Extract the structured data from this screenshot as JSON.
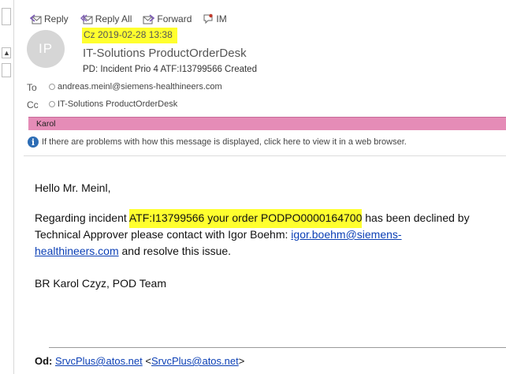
{
  "toolbar": {
    "reply": "Reply",
    "reply_all": "Reply All",
    "forward": "Forward",
    "im": "IM"
  },
  "header": {
    "avatar_initials": "IP",
    "date": "Cz 2019-02-28 13:38",
    "sender": "IT-Solutions ProductOrderDesk",
    "subject": "PD: Incident Prio 4 ATF:I13799566 Created",
    "to_label": "To",
    "to_value": "andreas.meinl@siemens-healthineers.com",
    "cc_label": "Cc",
    "cc_value": "IT-Solutions ProductOrderDesk",
    "category": "Karol",
    "info_text": "If there are problems with how this message is displayed, click here to view it in a web browser."
  },
  "body": {
    "greeting": "Hello Mr. Meinl,",
    "p1_a": "Regarding incident ",
    "p1_hl": "ATF:I13799566 your order PODPO0000164700",
    "p1_b": " has been declined by",
    "p2_a": "Technical Approver please contact with Igor Boehm: ",
    "p2_link1": "igor.boehm@siemens-",
    "p3_link2": "healthineers.com",
    "p3_b": " and resolve this issue.",
    "signature": "BR Karol Czyz, POD Team"
  },
  "quote": {
    "od_label": "Od:",
    "od_link": "SrvcPlus@atos.net",
    "od_lt": " <",
    "od_link2": "SrvcPlus@atos.net",
    "od_gt": ">"
  },
  "colors": {
    "highlight": "#ffff2e",
    "category": "#e58cb7",
    "link": "#0b3fb5",
    "info_icon": "#2d6db5"
  }
}
